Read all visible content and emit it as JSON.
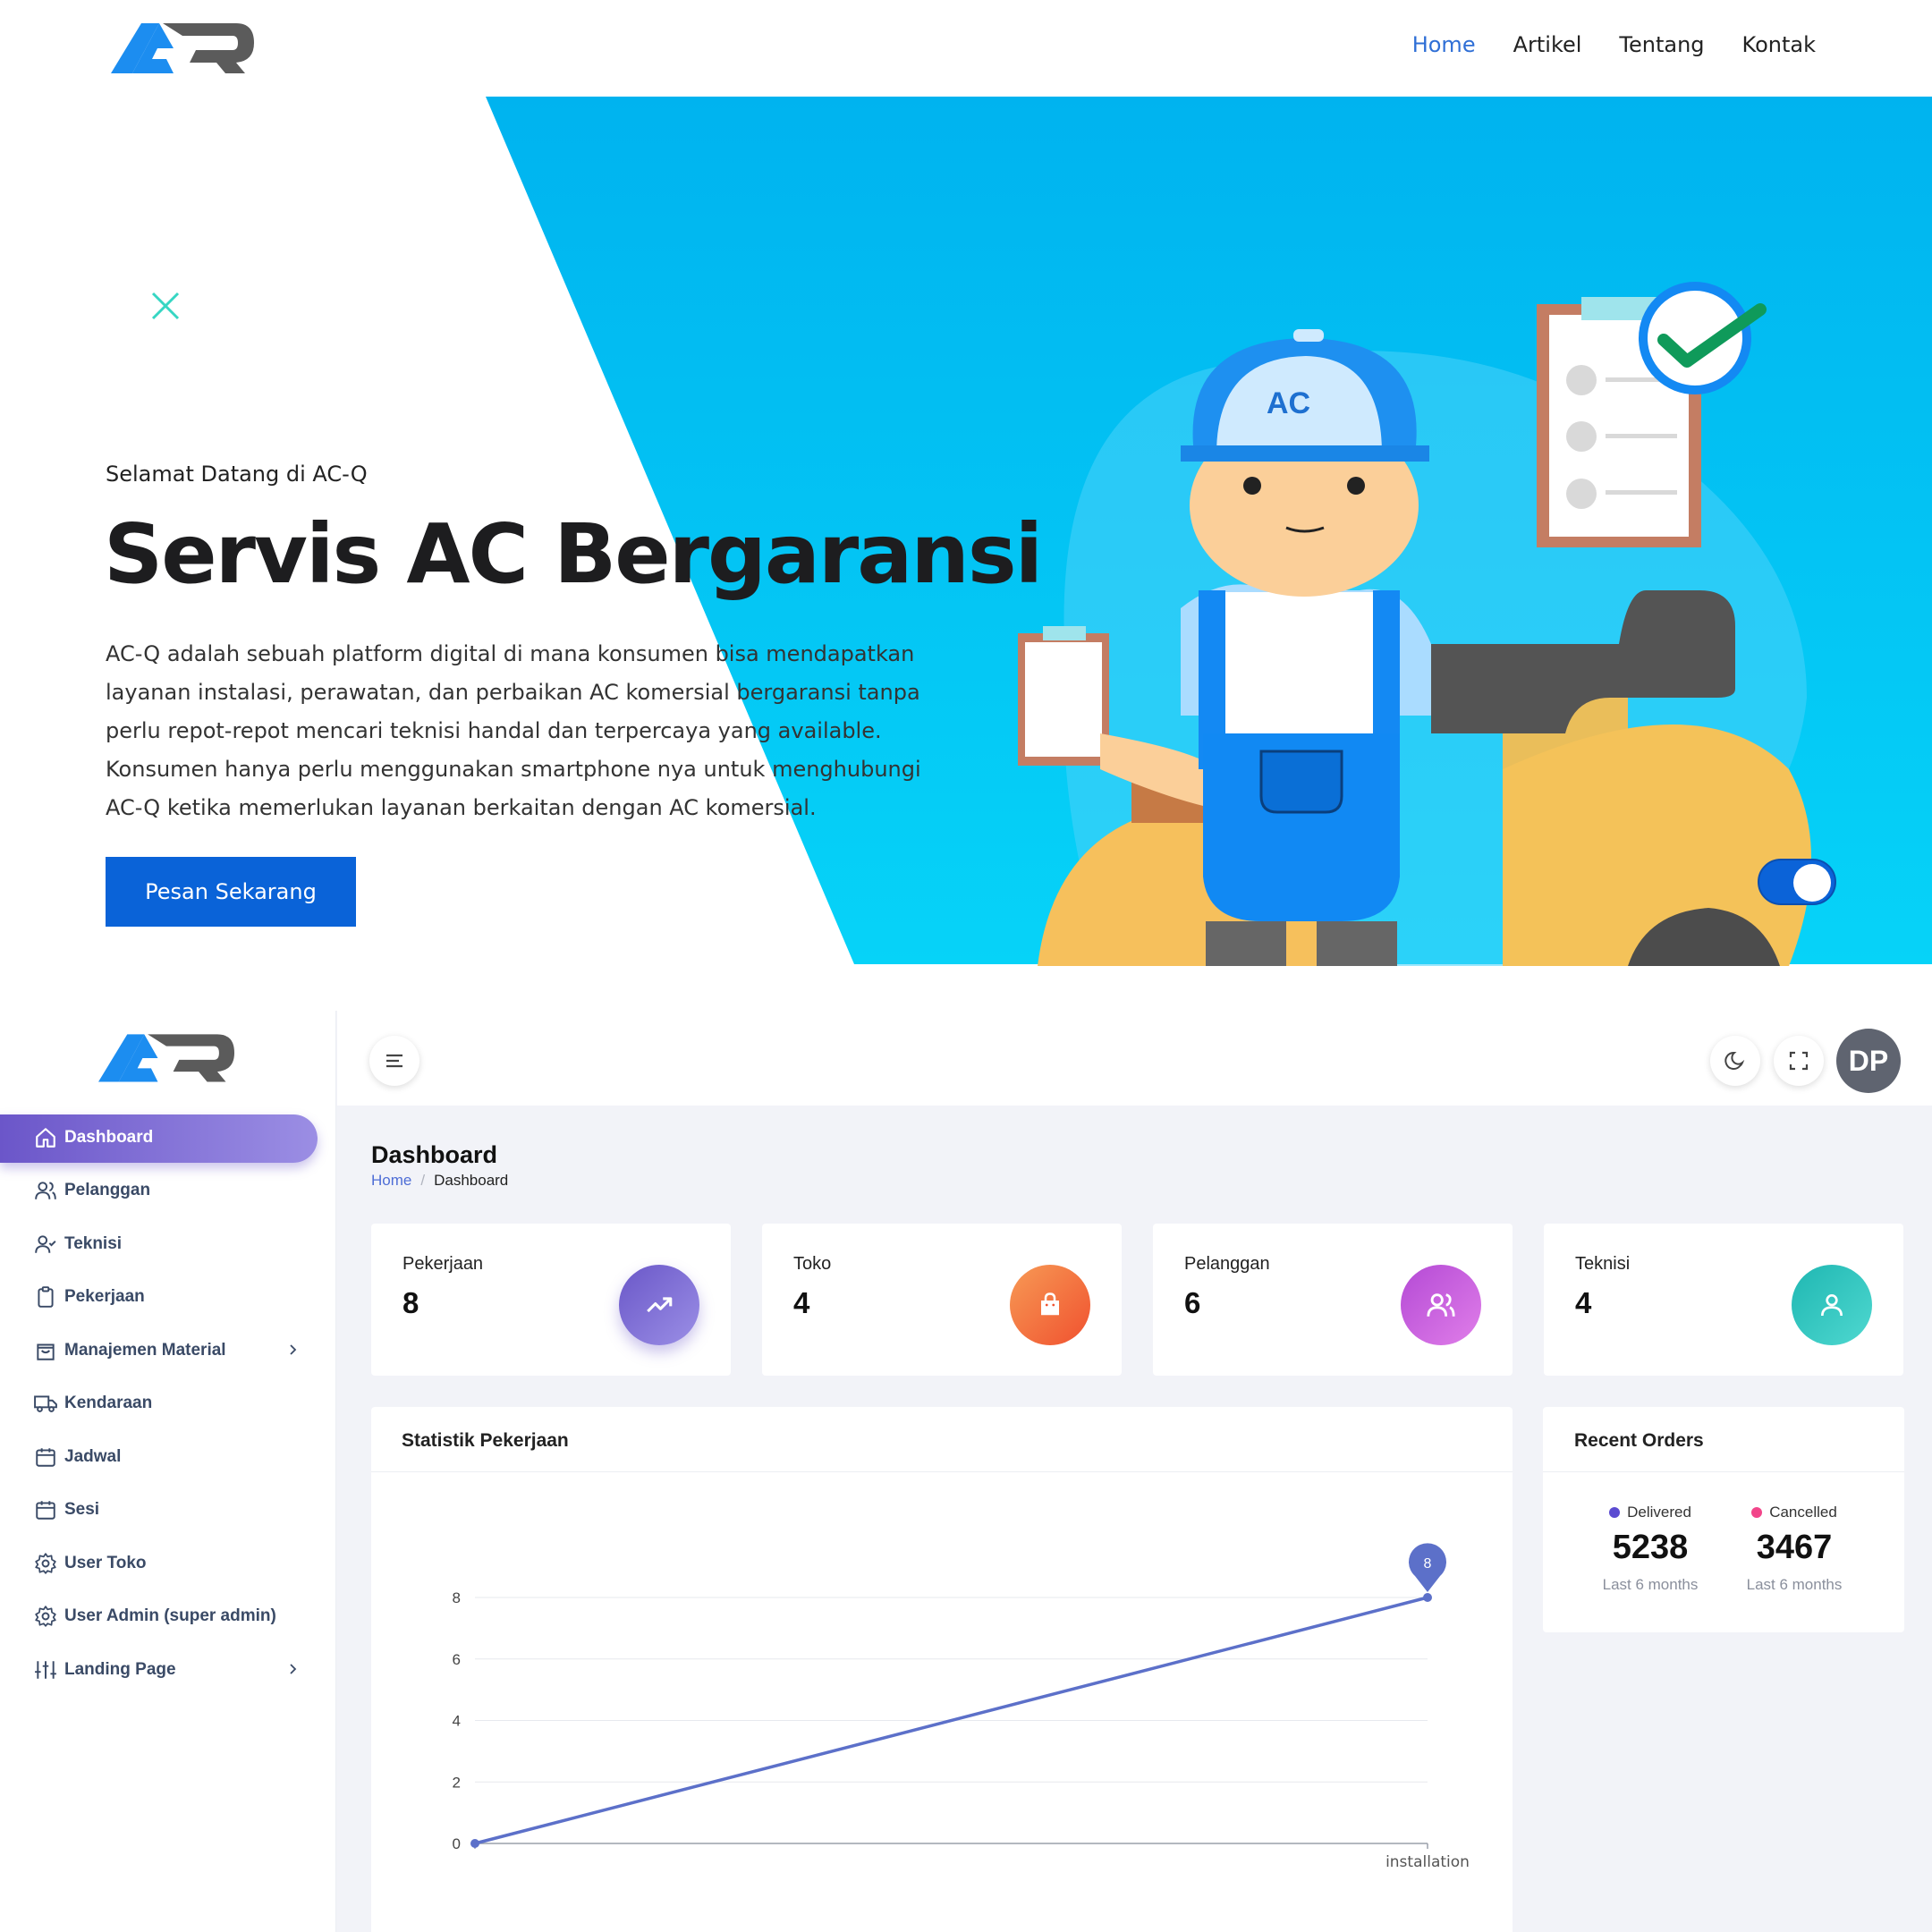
{
  "landing": {
    "nav": [
      "Home",
      "Artikel",
      "Tentang",
      "Kontak"
    ],
    "active_nav": "Home",
    "hero": {
      "subtitle": "Selamat Datang di AC-Q",
      "title": "Servis AC Bergaransi",
      "description": "AC-Q adalah sebuah platform digital di mana konsumen bisa mendapatkan layanan instalasi, perawatan, dan perbaikan AC komersial bergaransi tanpa perlu repot-repot mencari teknisi handal dan terpercaya yang available. Konsumen hanya perlu menggunakan smartphone nya untuk menghubungi AC-Q ketika memerlukan layanan berkaitan dengan AC komersial.",
      "cta": "Pesan Sekarang"
    },
    "colors": {
      "accent": "#0a63d8",
      "hero_bg_start": "#00b6f0",
      "hero_bg_end": "#05d3f8",
      "close_icon": "#36d6c3"
    },
    "icons": {
      "close": "close-icon"
    }
  },
  "dashboard": {
    "menu": [
      {
        "label": "Dashboard",
        "icon": "home-icon",
        "active": true
      },
      {
        "label": "Pelanggan",
        "icon": "users-icon"
      },
      {
        "label": "Teknisi",
        "icon": "user-check-icon"
      },
      {
        "label": "Pekerjaan",
        "icon": "clipboard-icon"
      },
      {
        "label": "Manajemen Material",
        "icon": "shopping-bag-icon",
        "has_submenu": true
      },
      {
        "label": "Kendaraan",
        "icon": "truck-icon"
      },
      {
        "label": "Jadwal",
        "icon": "calendar-icon"
      },
      {
        "label": "Sesi",
        "icon": "calendar-icon"
      },
      {
        "label": "User Toko",
        "icon": "gear-icon"
      },
      {
        "label": "User Admin (super admin)",
        "icon": "gear-icon"
      },
      {
        "label": "Landing Page",
        "icon": "sliders-icon",
        "has_submenu": true
      }
    ],
    "topbar": {
      "avatar_initials": "DP"
    },
    "page_title": "Dashboard",
    "breadcrumb": {
      "home": "Home",
      "separator": "/",
      "current": "Dashboard"
    },
    "stats": [
      {
        "label": "Pekerjaan",
        "value": "8",
        "icon": "trending-up-icon",
        "gradient": [
          "#6a57c8",
          "#9b8fe6"
        ]
      },
      {
        "label": "Toko",
        "value": "4",
        "icon": "shopping-bag-icon",
        "gradient": [
          "#f0512f",
          "#f79a55"
        ]
      },
      {
        "label": "Pelanggan",
        "value": "6",
        "icon": "users-icon",
        "gradient": [
          "#c050d8",
          "#e07ee9"
        ]
      },
      {
        "label": "Teknisi",
        "value": "4",
        "icon": "user-icon",
        "gradient": [
          "#1fb7b2",
          "#4fd8d0"
        ]
      }
    ],
    "chart_card_title": "Statistik Pekerjaan",
    "recent_orders": {
      "title": "Recent Orders",
      "items": [
        {
          "label": "Delivered",
          "value": "5238",
          "sub": "Last 6 months",
          "color": "#5b4bd1"
        },
        {
          "label": "Cancelled",
          "value": "3467",
          "sub": "Last 6 months",
          "color": "#f2458a"
        }
      ]
    }
  },
  "chart_data": {
    "type": "line",
    "categories": [
      "",
      "installation"
    ],
    "series": [
      {
        "values": [
          0,
          8
        ]
      }
    ],
    "ylim": [
      0,
      8
    ],
    "yticks": [
      0,
      2,
      4,
      6,
      8
    ],
    "data_label": "8",
    "color": "#5c70c9",
    "grid": true
  }
}
